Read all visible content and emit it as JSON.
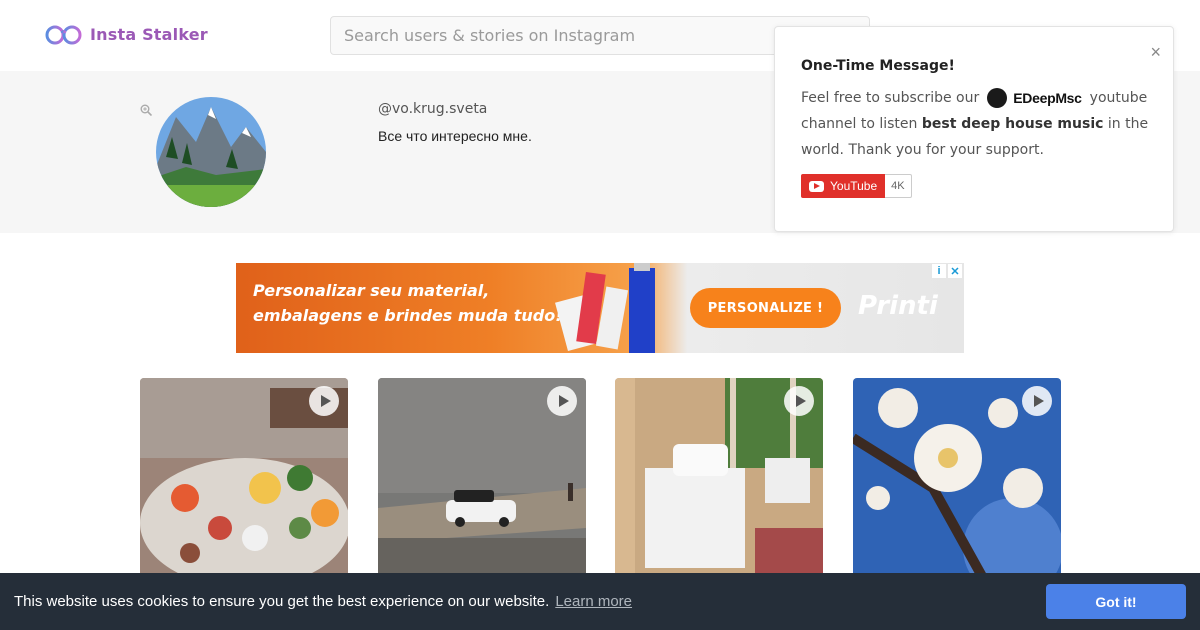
{
  "header": {
    "brand": "Insta Stalker",
    "search_placeholder": "Search users & stories on Instagram"
  },
  "profile": {
    "username": "@vo.krug.sveta",
    "bio": "Все что интересно мне."
  },
  "popup": {
    "title": "One-Time Message!",
    "text_before_brand": "Feel free to subscribe our",
    "brand_name": "EDeepMsc",
    "text_after_brand": "youtube channel to listen",
    "bold_phrase": "best deep house music",
    "text_end": "in the world. Thank you for your support.",
    "close_symbol": "×",
    "youtube_label": "YouTube",
    "youtube_count": "4K"
  },
  "ad": {
    "headline_line1": "Personalizar seu material,",
    "headline_line2": "embalagens e brindes muda tudo!",
    "cta_label": "PERSONALIZE !",
    "brand": "Printi"
  },
  "posts": [
    {
      "kind": "video",
      "icon": "play-icon",
      "description_color": "#8b6a55"
    },
    {
      "kind": "video",
      "icon": "play-icon",
      "description_color": "#7a7a78"
    },
    {
      "kind": "video",
      "icon": "play-icon",
      "description_color": "#c9a982"
    },
    {
      "kind": "video",
      "icon": "play-icon",
      "description_color": "#3d6fb8"
    }
  ],
  "cookie": {
    "message": "This website uses cookies to ensure you get the best experience on our website.",
    "link_label": "Learn more",
    "button_label": "Got it!"
  },
  "colors": {
    "brand_purple": "#9b59b6",
    "cookie_bg": "#252e39",
    "cookie_button": "#4b81e8",
    "youtube_red": "#e0302a",
    "ad_orange": "#f7821b"
  }
}
